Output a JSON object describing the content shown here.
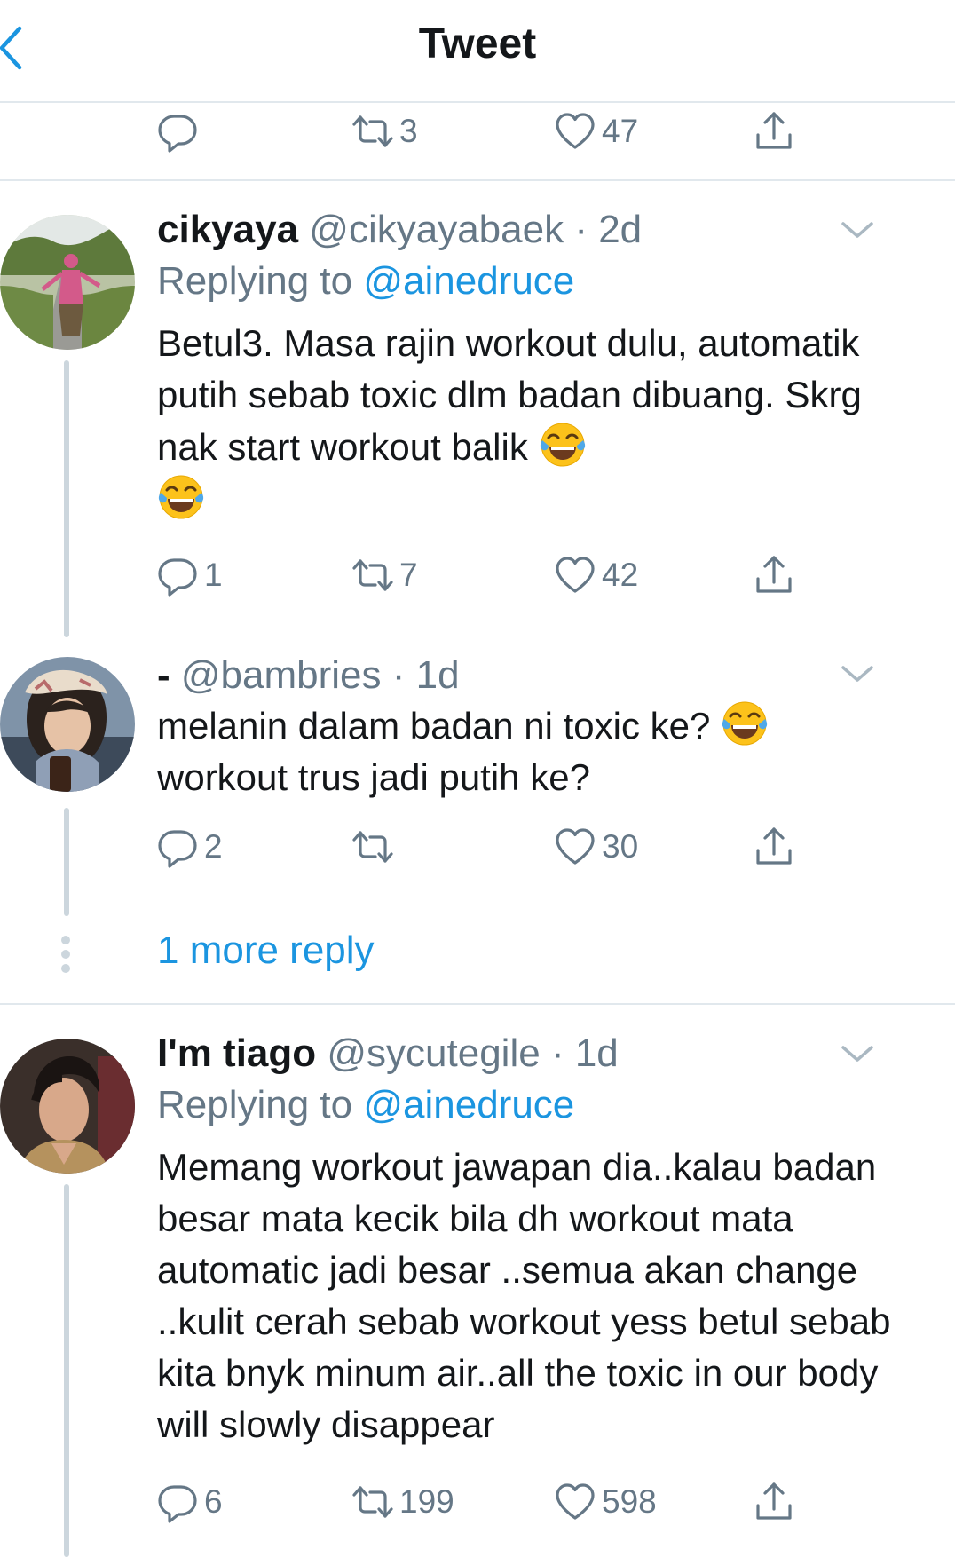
{
  "header": {
    "title": "Tweet"
  },
  "main_tweet_actions": {
    "replies": "",
    "retweets": "3",
    "likes": "47"
  },
  "replies": [
    {
      "name": "cikyaya",
      "handle": "@cikyayabaek",
      "time": "· 2d",
      "replying_prefix": "Replying to ",
      "replying_to": "@ainedruce",
      "text": "Betul3. Masa rajin workout dulu, automatik putih sebab toxic dlm badan dibuang. Skrg nak start workout balik",
      "replies": "1",
      "retweets": "7",
      "likes": "42"
    },
    {
      "name": "-",
      "handle": "@bambries",
      "time": "· 1d",
      "text_line1": "melanin dalam badan ni toxic ke?",
      "text_line2": "workout trus jadi putih ke?",
      "replies": "2",
      "retweets": "",
      "likes": "30"
    },
    {
      "more_replies": "1 more reply"
    },
    {
      "name": "I'm tiago",
      "handle": "@sycutegile",
      "time": "· 1d",
      "replying_prefix": "Replying to ",
      "replying_to": "@ainedruce",
      "text": "Memang workout jawapan dia..kalau badan besar mata kecik bila dh workout mata automatic jadi besar ..semua akan change ..kulit cerah sebab workout yess betul sebab kita bnyk minum air..all the toxic in our body will slowly disappear",
      "replies": "6",
      "retweets": "199",
      "likes": "598"
    }
  ],
  "colors": {
    "accent": "#1b95e0",
    "muted": "#657786",
    "text": "#14171a",
    "divider": "#e1e8ed"
  },
  "icons": [
    "back-chevron-icon",
    "reply-icon",
    "retweet-icon",
    "like-icon",
    "share-icon",
    "chevron-down-icon",
    "tears-of-joy-emoji"
  ]
}
